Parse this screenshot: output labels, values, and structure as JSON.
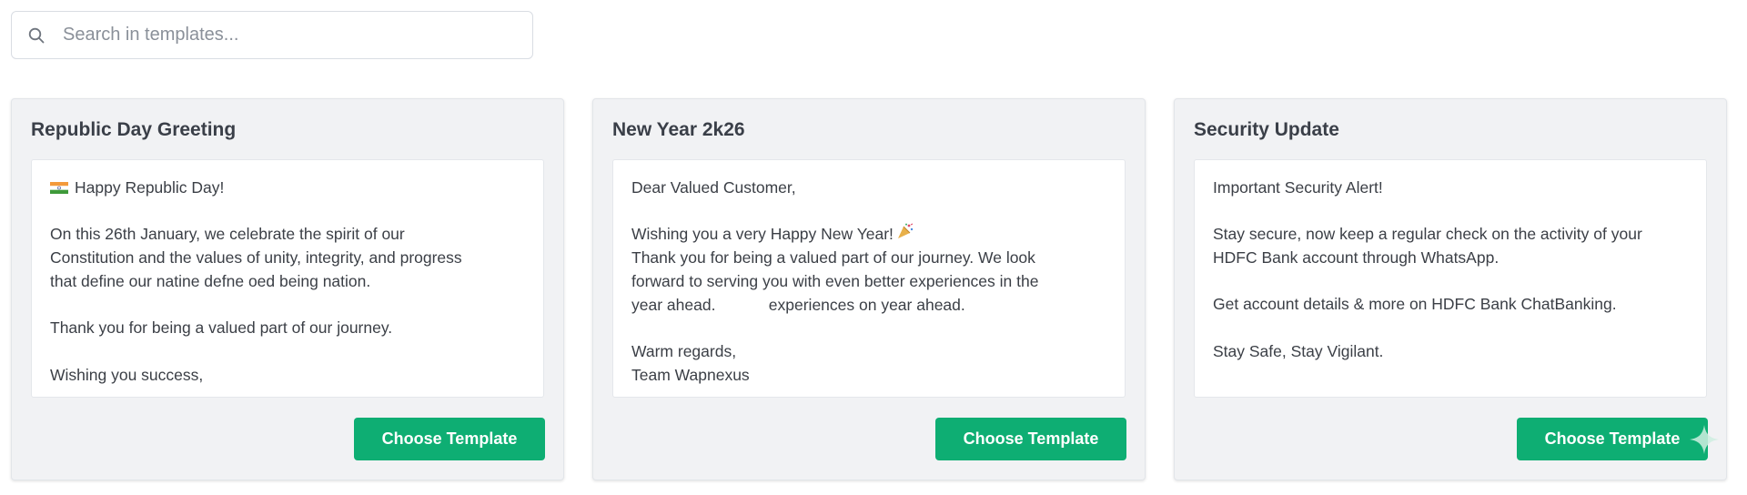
{
  "search": {
    "placeholder": "Search in templates...",
    "value": "",
    "icon": "search-icon"
  },
  "cards": [
    {
      "title": "Republic Day Greeting",
      "lines": [
        "Happy Republic Day!",
        "",
        "On this 26th January, we celebrate the spirit of our",
        "Constitution and the values of unity, integrity, and progress",
        "that define our natine defne oed being nation.",
        "",
        "Thank you for being a valued part of our journey.",
        "",
        "Wishing you success,"
      ],
      "button": "Choose Template"
    },
    {
      "title": "New Year 2k26",
      "lines": [
        "Dear Valued Customer,",
        "",
        "Wishing you a very Happy New Year!",
        "Thank you for being a valued part of our journey. We look",
        "forward to serving you with even better experiences in the",
        "year ahead.            experiences on year ahead.",
        "",
        "Warm regards,",
        "Team Wapnexus"
      ],
      "button": "Choose Template"
    },
    {
      "title": "Security Update",
      "lines": [
        "Important Security Alert!",
        "",
        "Stay secure, now keep a regular check on the activity of your",
        "HDFC Bank account through WhatsApp.",
        "",
        "Get account details & more on HDFC Bank ChatBanking.",
        "",
        "Stay Safe, Stay Vigilant."
      ],
      "button": "Choose Template"
    }
  ],
  "colors": {
    "accent": "#0eae73",
    "card_background": "#f1f2f4",
    "text": "#3b3f46"
  }
}
